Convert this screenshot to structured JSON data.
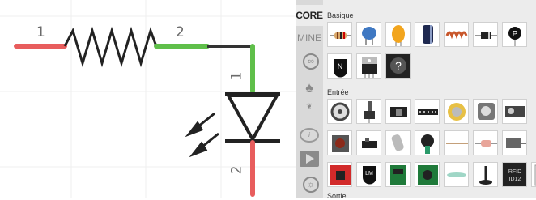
{
  "canvas": {
    "resistor": {
      "pin1_label": "1",
      "pin2_label": "2"
    },
    "led": {
      "pin1_label": "1",
      "pin2_label": "2"
    },
    "colors": {
      "wire_red": "#e85d5d",
      "wire_green": "#5fbf4a",
      "wire_black": "#222222",
      "grid": "#efefef"
    }
  },
  "bin_tabs": {
    "core_label": "CORE",
    "mine_label": "MINE",
    "icons": [
      "arduino-icon",
      "sparkfun-icon",
      "seeed-icon",
      "intel-icon",
      "play-icon",
      "sun-icon"
    ]
  },
  "parts_bin": {
    "sections": [
      {
        "title": "Basique",
        "items": [
          "resistor",
          "ceramic-capacitor",
          "tantalum-capacitor",
          "electrolytic-capacitor",
          "inductor",
          "diode",
          "power-label",
          "n-transistor",
          "voltage-regulator",
          "mystery-part"
        ]
      },
      {
        "title": "Entrée",
        "items": [
          "potentiometer",
          "trimmer-pot",
          "slide-pot",
          "header-pins",
          "rotary-encoder",
          "piezo",
          "servo-input",
          "pushbutton",
          "switch",
          "reed-switch",
          "tilt-sensor",
          "ir-sensor",
          "photocell",
          "flex-sensor",
          "temperature-sensor",
          "accelerometer",
          "sensor-ic",
          "rfid-module",
          "reed-glass",
          "joystick",
          "rfid-reader",
          "dht-sensor"
        ]
      },
      {
        "title": "Sortie",
        "items": []
      }
    ],
    "mystery_glyph": "?",
    "rfid_text": [
      "RFID",
      "ID12"
    ]
  }
}
